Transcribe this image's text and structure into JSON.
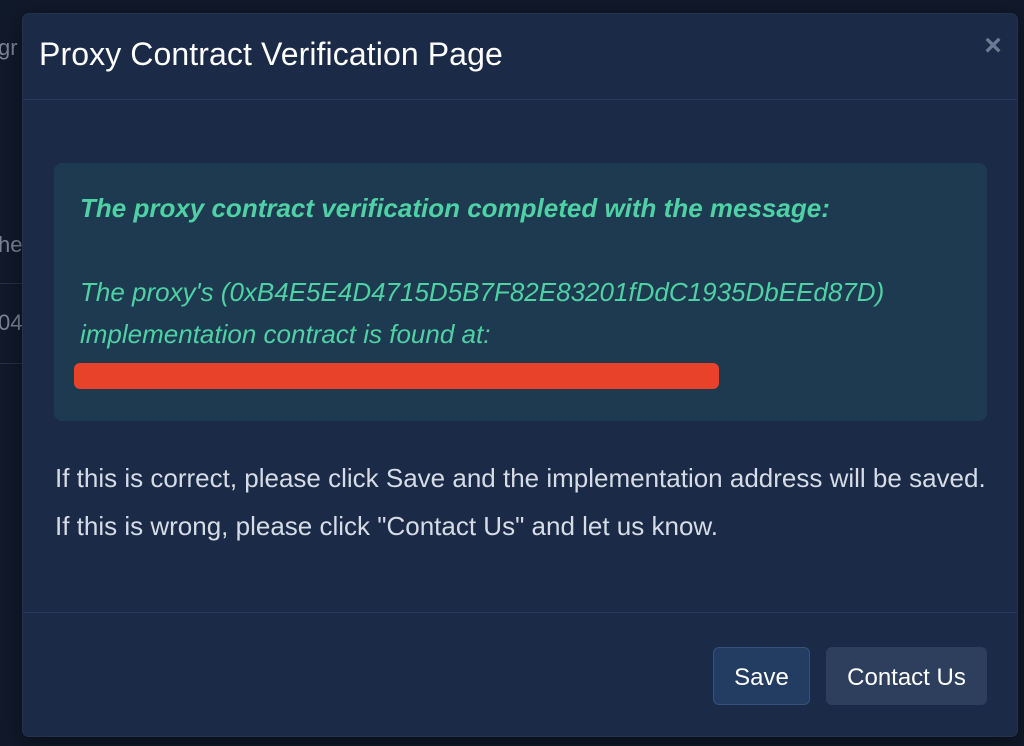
{
  "background": {
    "fragments": [
      "gr",
      "he",
      "04"
    ]
  },
  "modal": {
    "title": "Proxy Contract Verification Page",
    "close_symbol": "×",
    "alert": {
      "heading": "The proxy contract verification completed with the message:",
      "line1": "The proxy's (0xB4E5E4D4715D5B7F82E83201fDdC1935DbEEd87D)",
      "line2": "implementation contract is found at:",
      "redacted_color": "#e8432a"
    },
    "body": "If this is correct, please click Save and the implementation address will be saved. If this is wrong, please click \"Contact Us\" and let us know.",
    "buttons": {
      "save_label": "Save",
      "contact_label": "Contact Us"
    }
  },
  "colors": {
    "modal_bg": "#1b2a47",
    "alert_bg": "#1e3a50",
    "alert_text": "#4fd1a5"
  }
}
